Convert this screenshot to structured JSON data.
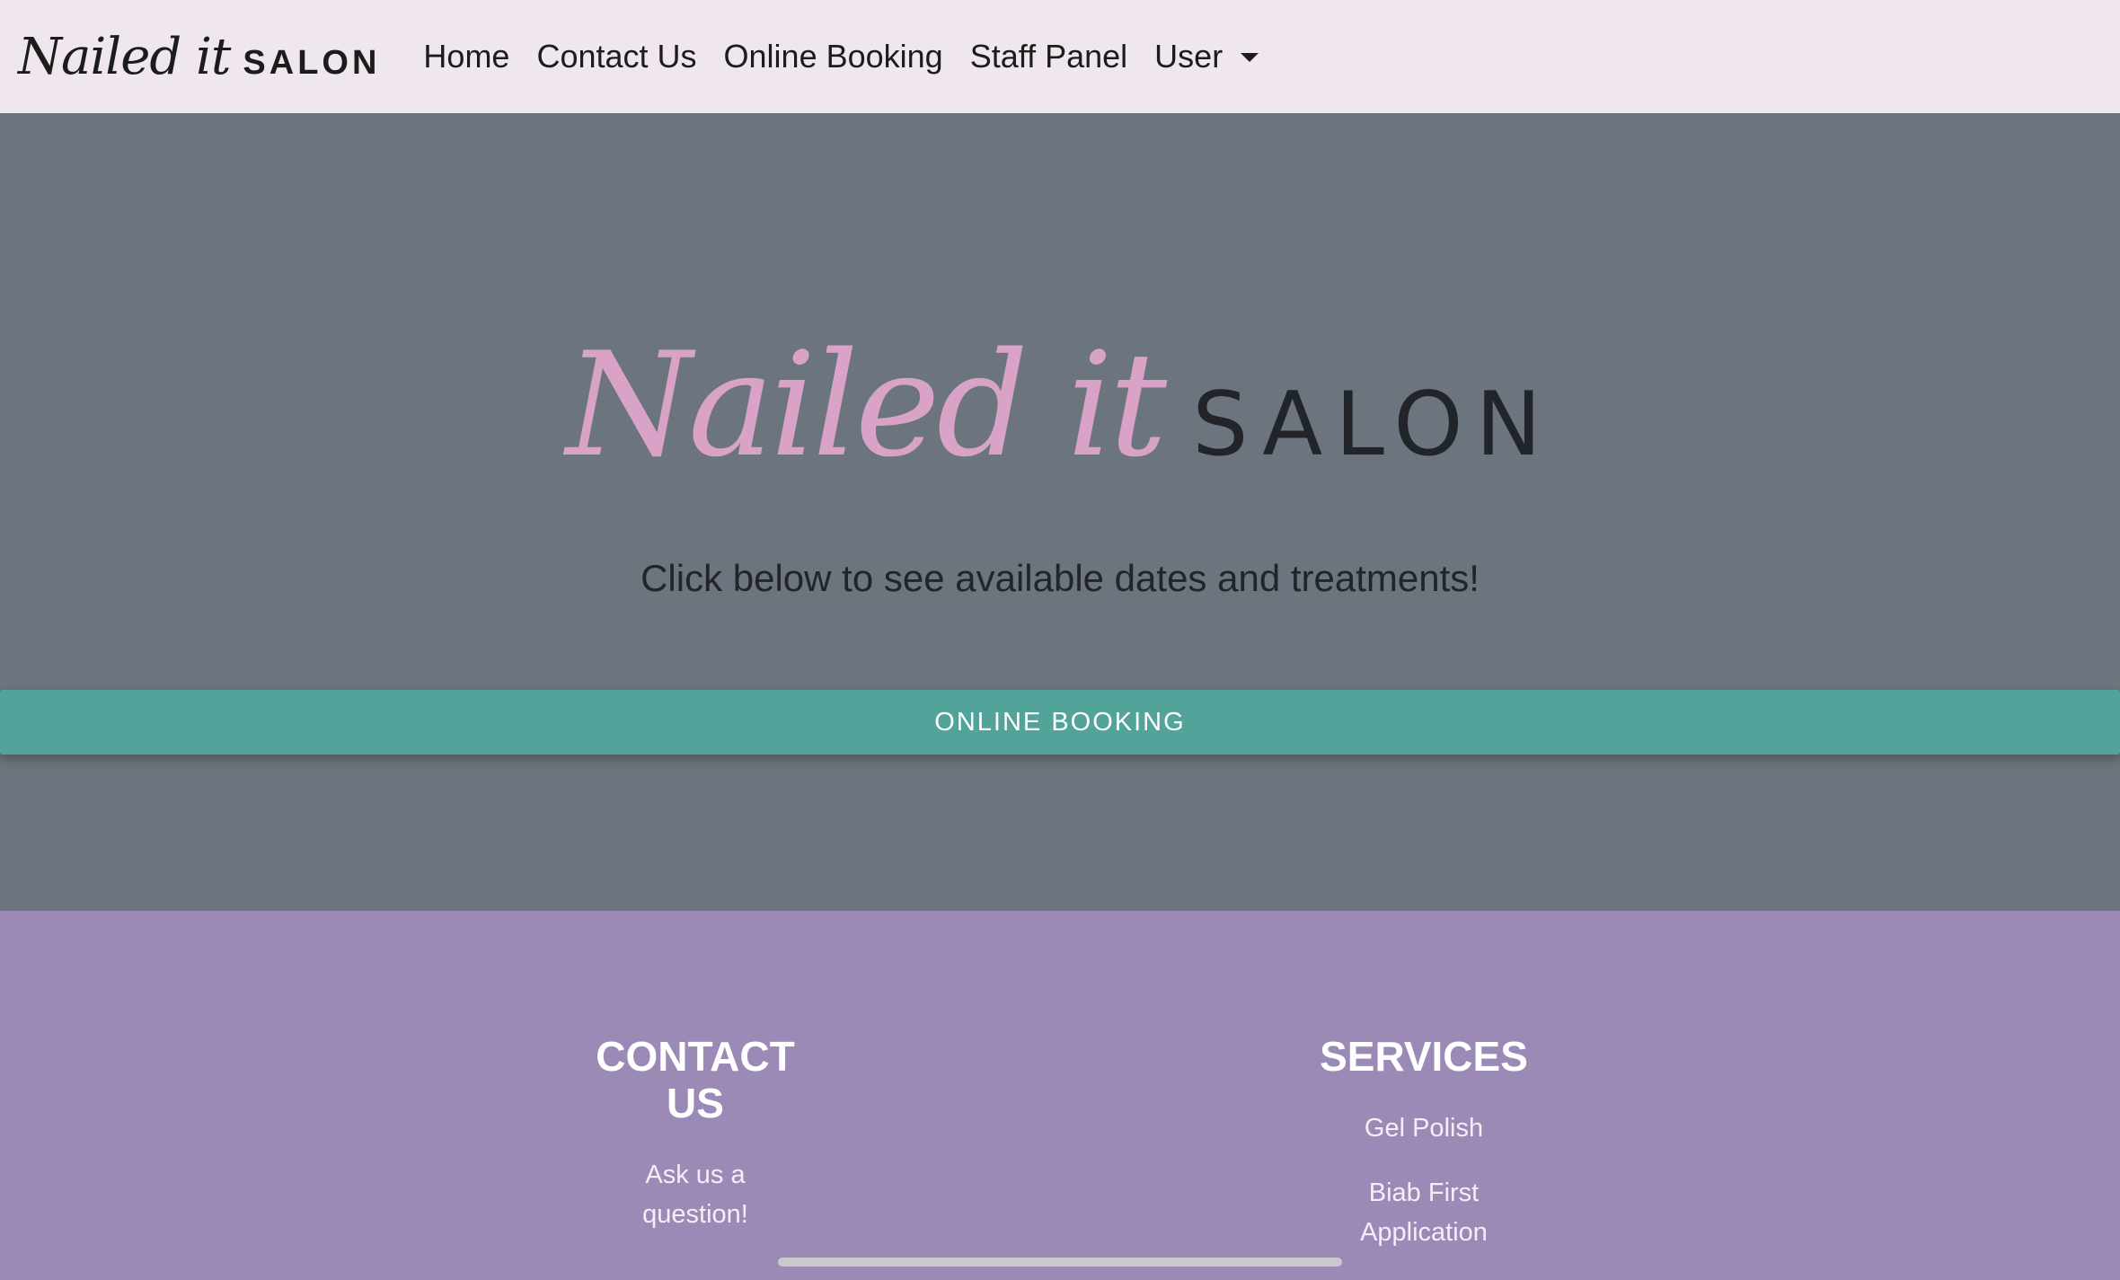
{
  "navbar": {
    "brand_script": "Nailed it",
    "brand_salon": "SALON",
    "links": [
      "Home",
      "Contact Us",
      "Online Booking",
      "Staff Panel"
    ],
    "user_menu": "User"
  },
  "hero": {
    "logo_script": "Nailed it",
    "logo_salon": "SALON",
    "subtitle": "Click below to see available dates and treatments!",
    "button_label": "ONLINE BOOKING"
  },
  "footer": {
    "contact": {
      "heading": "CONTACT US",
      "items": [
        "Ask us a question!"
      ]
    },
    "services": {
      "heading": "SERVICES",
      "items": [
        "Gel Polish",
        "Biab First Application"
      ]
    }
  },
  "colors": {
    "navbar_bg": "#efe6ee",
    "hero_bg": "#6c757d",
    "hero_script": "#d9a3c7",
    "button_bg": "#52a39a",
    "footer_bg": "#9b8ab6"
  }
}
